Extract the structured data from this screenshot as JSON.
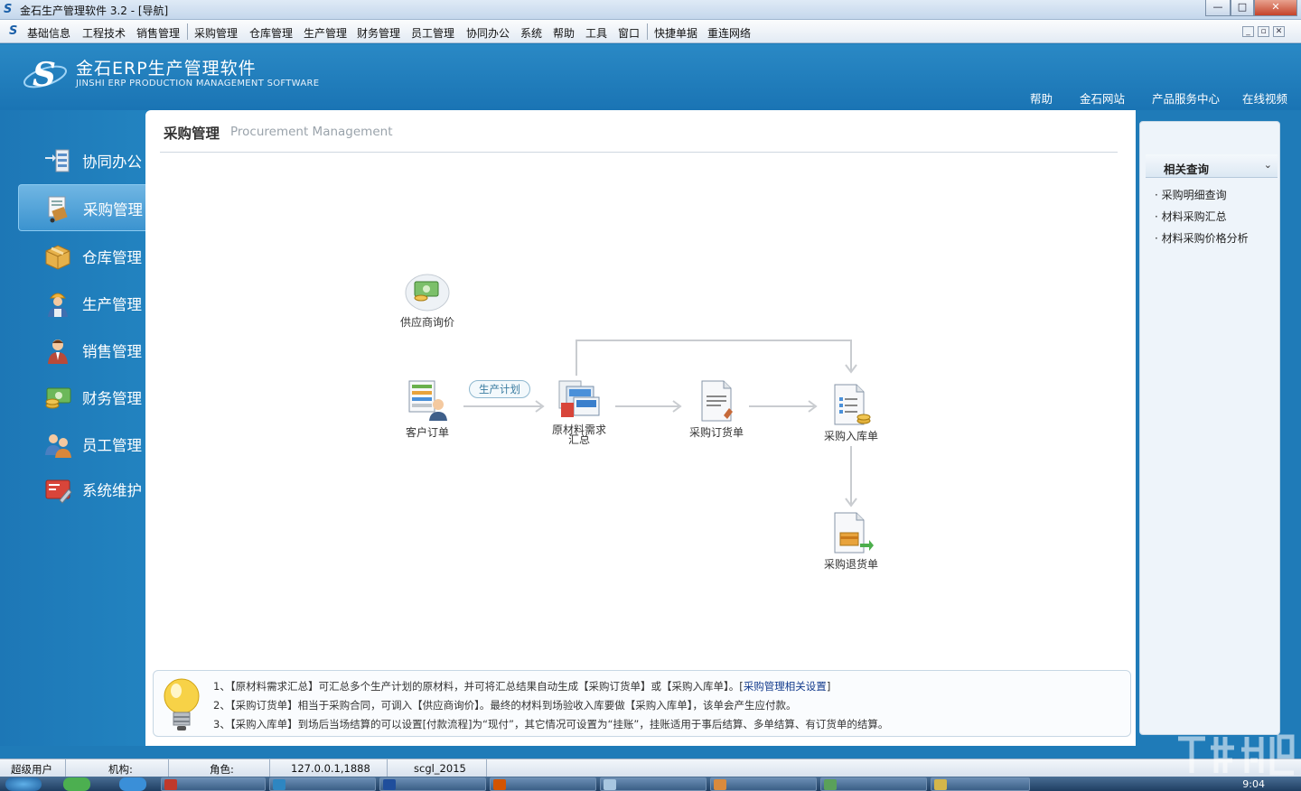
{
  "window": {
    "title": "金石生产管理软件 3.2 - [导航]",
    "app_icon": "S",
    "buttons": {
      "minimize": "—",
      "maximize": "□",
      "close": "✕"
    }
  },
  "menu": {
    "items": [
      "基础信息",
      "工程技术",
      "销售管理",
      "采购管理",
      "仓库管理",
      "生产管理",
      "财务管理",
      "员工管理",
      "协同办公",
      "系统",
      "帮助",
      "工具",
      "窗口",
      "快捷单据",
      "重连网络"
    ],
    "mdi_buttons": [
      "_",
      "▫",
      "✕"
    ]
  },
  "header": {
    "brand_cn": "金石ERP生产管理软件",
    "brand_en": "JINSHI ERP PRODUCTION MANAGEMENT SOFTWARE",
    "links": [
      "帮助",
      "金石网站",
      "产品服务中心",
      "在线视频"
    ]
  },
  "sidebar": {
    "items": [
      {
        "label": "协同办公",
        "icon": "office-icon",
        "active": false
      },
      {
        "label": "采购管理",
        "icon": "procurement-icon",
        "active": true
      },
      {
        "label": "仓库管理",
        "icon": "warehouse-box-icon",
        "active": false
      },
      {
        "label": "生产管理",
        "icon": "worker-icon",
        "active": false
      },
      {
        "label": "销售管理",
        "icon": "sales-person-icon",
        "active": false
      },
      {
        "label": "财务管理",
        "icon": "money-icon",
        "active": false
      },
      {
        "label": "员工管理",
        "icon": "employees-icon",
        "active": false
      },
      {
        "label": "系统维护",
        "icon": "system-tools-icon",
        "active": false
      }
    ]
  },
  "page": {
    "title": "采购管理",
    "subtitle": "Procurement Management",
    "flow": {
      "supplier_quote": "供应商询价",
      "customer_order": "客户订单",
      "production_plan": "生产计划",
      "material_summary_line1": "原材料需求",
      "material_summary_line2": "汇总",
      "purchase_order": "采购订货单",
      "purchase_receipt": "采购入库单",
      "purchase_return": "采购退货单"
    },
    "tips": {
      "line1": "1、【原材料需求汇总】可汇总多个生产计划的原材料，并可将汇总结果自动生成【采购订货单】或【采购入库单】。[",
      "line1_link": "采购管理相关设置",
      "line1_end": "]",
      "line2": "2、【采购订货单】相当于采购合同，可调入【供应商询价】。最终的材料到场验收入库要做【采购入库单】，该单会产生应付款。",
      "line3": "3、【采购入库单】到场后当场结算的可以设置[付款流程]为“现付”，其它情况可设置为“挂账”，挂账适用于事后结算、多单结算、有订货单的结算。"
    }
  },
  "right_panel": {
    "header": "相关查询",
    "links": [
      "采购明细查询",
      "材料采购汇总",
      "材料采购价格分析"
    ]
  },
  "status": {
    "user": "超级用户",
    "org_label": "机构:",
    "role_label": "角色:",
    "server": "127.0.0.1,1888",
    "database": "scgl_2015"
  },
  "taskbar": {
    "clock": "9:04",
    "colors": [
      "#c0392b",
      "#8e44ad",
      "#2e86c1",
      "#1f4e9c",
      "#d35400",
      "#a8c6e0",
      "#d98a3d",
      "#5aa05a",
      "#d4b64a"
    ]
  },
  "colors": {
    "accent": "#1f7bb8",
    "active_nav": "#4aa0d8",
    "flow_arrow": "#c9ccd0"
  }
}
